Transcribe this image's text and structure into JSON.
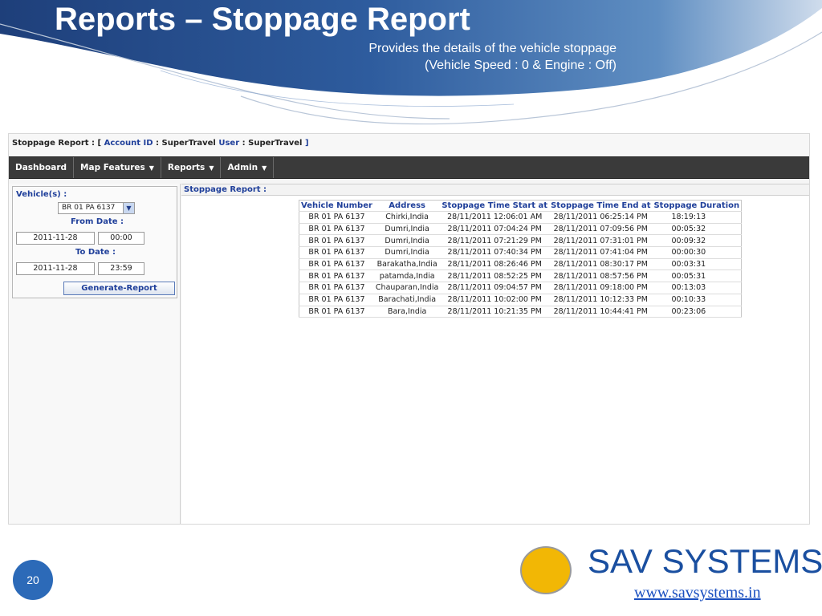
{
  "slide": {
    "title": "Reports – Stoppage Report",
    "subtitle_line1": "Provides the details of the vehicle stoppage",
    "subtitle_line2": "(Vehicle Speed : 0 & Engine : Off)",
    "page_number": "20"
  },
  "app": {
    "header": {
      "prefix": "Stoppage Report : [ ",
      "account_label": "Account ID",
      "account_value": " : SuperTravel ",
      "user_label": "User",
      "user_value": " : SuperTravel ",
      "suffix": "]"
    },
    "menu": [
      {
        "label": "Dashboard",
        "has_dropdown": false
      },
      {
        "label": "Map Features",
        "has_dropdown": true
      },
      {
        "label": "Reports",
        "has_dropdown": true
      },
      {
        "label": "Admin",
        "has_dropdown": true
      }
    ],
    "filters": {
      "vehicles_label": "Vehicle(s) :",
      "vehicle_selected": "BR 01 PA 6137",
      "from_date_label": "From Date :",
      "from_date": "2011-11-28",
      "from_time": "00:00",
      "to_date_label": "To Date :",
      "to_date": "2011-11-28",
      "to_time": "23:59",
      "generate_button": "Generate-Report"
    },
    "report": {
      "heading": "Stoppage Report :",
      "columns": [
        "Vehicle Number",
        "Address",
        "Stoppage Time Start at",
        "Stoppage Time End at",
        "Stoppage Duration"
      ],
      "rows": [
        [
          "BR 01 PA 6137",
          "Chirki,India",
          "28/11/2011 12:06:01 AM",
          "28/11/2011 06:25:14 PM",
          "18:19:13"
        ],
        [
          "BR 01 PA 6137",
          "Dumri,India",
          "28/11/2011 07:04:24 PM",
          "28/11/2011 07:09:56 PM",
          "00:05:32"
        ],
        [
          "BR 01 PA 6137",
          "Dumri,India",
          "28/11/2011 07:21:29 PM",
          "28/11/2011 07:31:01 PM",
          "00:09:32"
        ],
        [
          "BR 01 PA 6137",
          "Dumri,India",
          "28/11/2011 07:40:34 PM",
          "28/11/2011 07:41:04 PM",
          "00:00:30"
        ],
        [
          "BR 01 PA 6137",
          "Barakatha,India",
          "28/11/2011 08:26:46 PM",
          "28/11/2011 08:30:17 PM",
          "00:03:31"
        ],
        [
          "BR 01 PA 6137",
          "patamda,India",
          "28/11/2011 08:52:25 PM",
          "28/11/2011 08:57:56 PM",
          "00:05:31"
        ],
        [
          "BR 01 PA 6137",
          "Chauparan,India",
          "28/11/2011 09:04:57 PM",
          "28/11/2011 09:18:00 PM",
          "00:13:03"
        ],
        [
          "BR 01 PA 6137",
          "Barachati,India",
          "28/11/2011 10:02:00 PM",
          "28/11/2011 10:12:33 PM",
          "00:10:33"
        ],
        [
          "BR 01 PA 6137",
          "Bara,India",
          "28/11/2011 10:21:35 PM",
          "28/11/2011 10:44:41 PM",
          "00:23:06"
        ]
      ]
    }
  },
  "brand": {
    "name": "SAV SYSTEMS",
    "url": "www.savsystems.in"
  },
  "colors": {
    "banner_dark": "#1e3f7a",
    "banner_light": "#5f8ec2",
    "menu_bar": "#3a3a3a",
    "link_blue": "#1f3f9a",
    "logo_yellow": "#f2b705",
    "brand_blue": "#1a4fa0"
  }
}
